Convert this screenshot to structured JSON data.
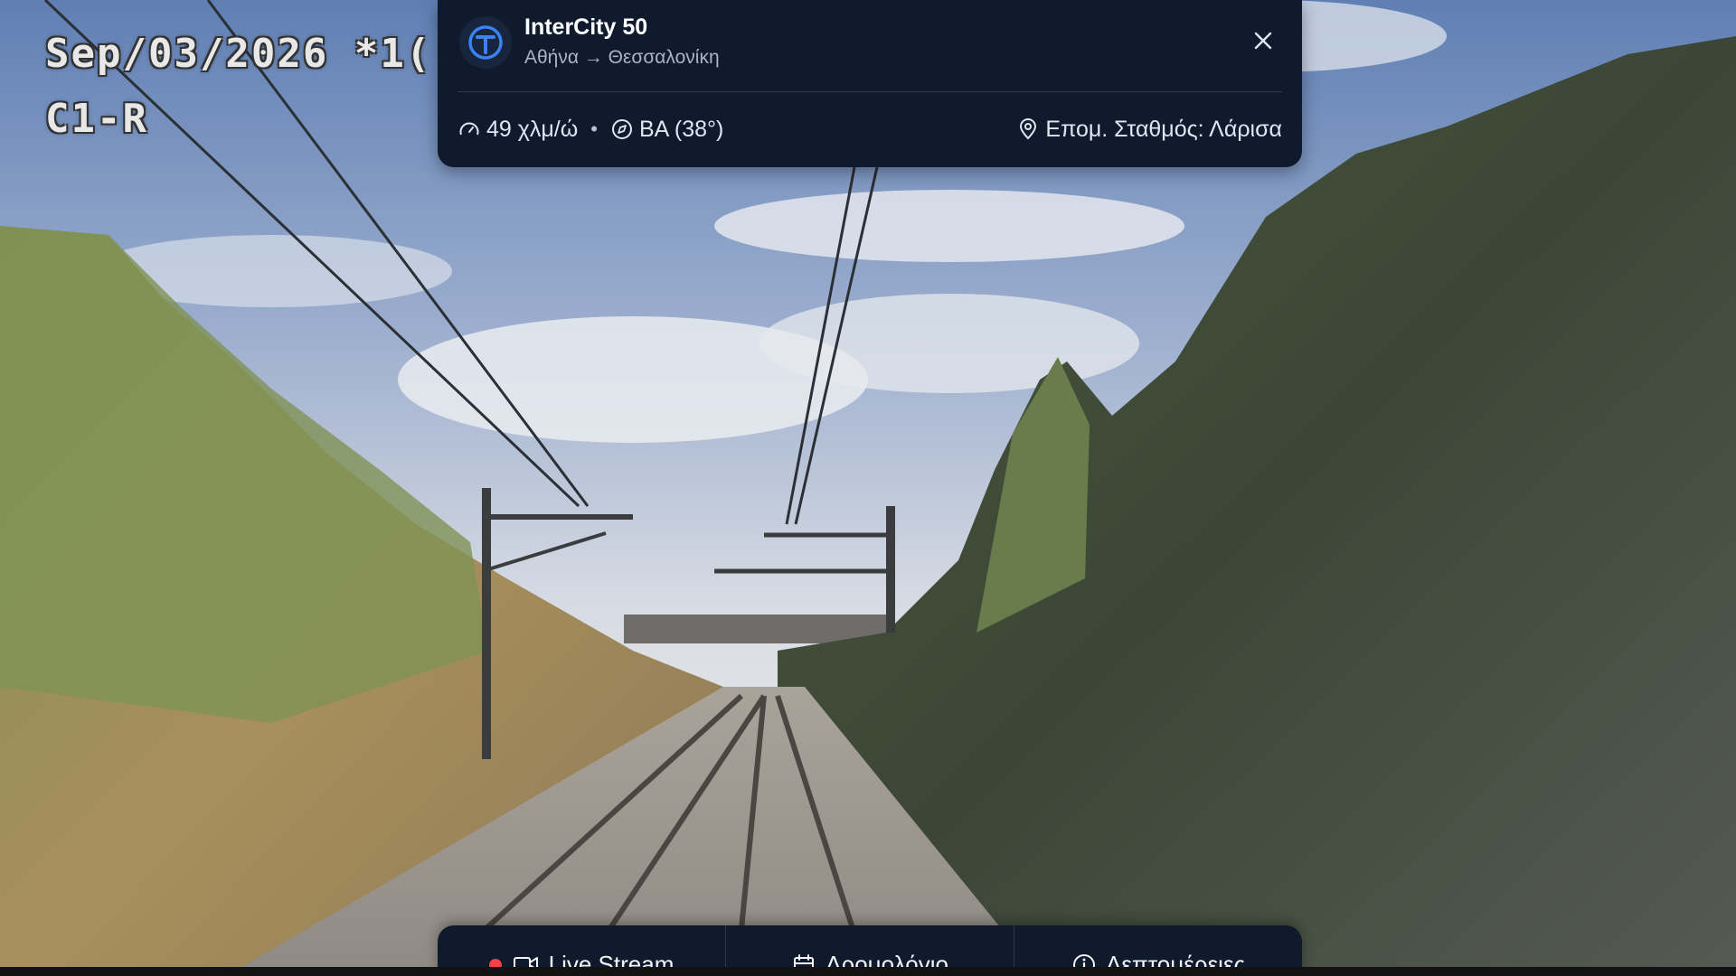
{
  "camera_overlay": {
    "date_text": "Sep/03/2026 *1(",
    "camera_id": "C1-R"
  },
  "train_card": {
    "title": "InterCity 50",
    "route": "Αθήνα → Θεσσαλονίκη",
    "close_icon": "close-icon",
    "speed": "49 χλμ/ώ",
    "separator": "•",
    "heading": "ΒΑ (38°)",
    "next_station": "Επομ. Σταθμός: Λάρισα",
    "brand_color": "#3b82f6"
  },
  "action_bar": {
    "live_stream_label": "Live Stream",
    "schedule_label": "Δρομολόγιο",
    "details_label": "Λεπτομέρειες",
    "live_dot_color": "#ef4444"
  }
}
